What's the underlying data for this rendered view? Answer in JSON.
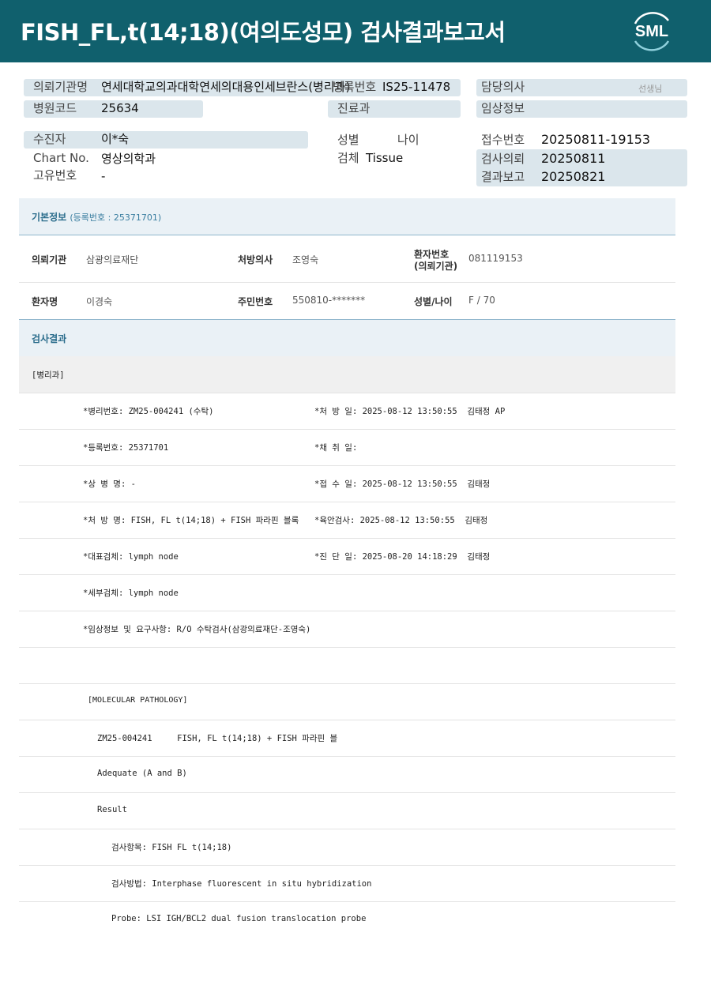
{
  "header": {
    "title": "FISH_FL,t(14;18)(여의도성모) 검사결과보고서",
    "logo_text": "SML"
  },
  "patient_info": {
    "institution_label": "의뢰기관명",
    "institution_value": "연세대학교의과대학연세의대용인세브란스(병리과)",
    "patient_no_label": "병록번호",
    "patient_no_value": "IS25-11478",
    "doctor_label": "담당의사",
    "doctor_suffix": "선생님",
    "hospital_code_label": "병원코드",
    "hospital_code_value": "25634",
    "department_label": "진료과",
    "clinical_label": "임상정보",
    "examinee_label": "수진자",
    "examinee_value": "이*숙",
    "gender_label": "성별",
    "age_label": "나이",
    "receipt_label": "접수번호",
    "receipt_value": "20250811-19153",
    "chart_label": "Chart No.",
    "chart_value": "영상의학과",
    "specimen_label": "검체",
    "specimen_value": "Tissue",
    "request_label": "검사의뢰",
    "request_value": "20250811",
    "unique_label": "고유번호",
    "unique_value": "-",
    "report_label": "결과보고",
    "report_value": "20250821"
  },
  "basic_info": {
    "title": "기본정보",
    "subtitle": "(등록번호 : 25371701)",
    "row1": {
      "inst_label": "의뢰기관",
      "inst_value": "삼광의료재단",
      "doc_label": "처방의사",
      "doc_value": "조영숙",
      "pno_label_1": "환자번호",
      "pno_label_2": "(의뢰기관)",
      "pno_value": "081119153"
    },
    "row2": {
      "name_label": "환자명",
      "name_value": "이경숙",
      "rrn_label": "주민번호",
      "rrn_value": "550810-*******",
      "sex_label": "성별/나이",
      "sex_value": "F / 70"
    }
  },
  "results": {
    "title": "검사결과",
    "dept": "[병리과]",
    "left": [
      "*병리번호: ZM25-004241 (수탁)",
      "*등록번호: 25371701",
      "*상 병 명: -",
      "*처 방 명: FISH, FL t(14;18) + FISH 파라핀 블록",
      "*대표검체: lymph node",
      "*세부검체: lymph node",
      "*임상정보 및 요구사항: R/O 수탁검사(삼광의료재단-조영숙)"
    ],
    "right": [
      "*처 방 일: 2025-08-12 13:50:55  김태정 AP",
      "*채 취 일:",
      "*접 수 일: 2025-08-12 13:50:55  김태정",
      "*육안검사: 2025-08-12 13:50:55  김태정",
      "*진 단 일: 2025-08-20 14:18:29  김태정"
    ],
    "molecular": {
      "title": "[MOLECULAR PATHOLOGY]",
      "case_line": "ZM25-004241     FISH, FL t(14;18) + FISH 파라핀 블",
      "adequacy": "Adequate (A and B)",
      "result_label": "Result",
      "item": "검사항목: FISH FL t(14;18)",
      "method": "검사방법: Interphase fluorescent in situ hybridization",
      "probe": "Probe: LSI IGH/BCL2 dual fusion translocation probe"
    }
  }
}
